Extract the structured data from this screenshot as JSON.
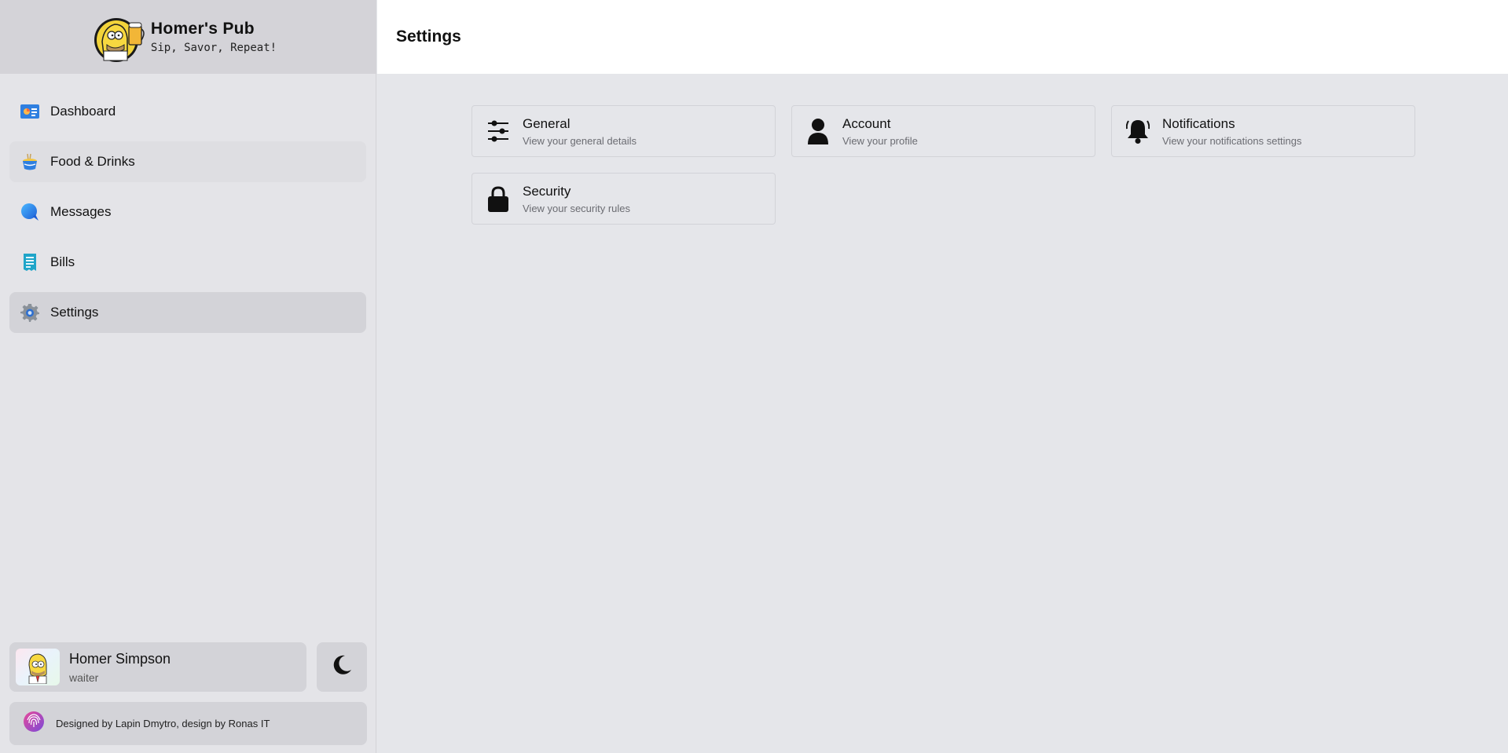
{
  "brand": {
    "title": "Homer's Pub",
    "subtitle": "Sip, Savor, Repeat!",
    "logo_icon": "homer-beer-logo-icon"
  },
  "sidebar": {
    "items": [
      {
        "label": "Dashboard",
        "icon": "dashboard-icon"
      },
      {
        "label": "Food & Drinks",
        "icon": "food-bowl-icon"
      },
      {
        "label": "Messages",
        "icon": "speech-bubble-icon"
      },
      {
        "label": "Bills",
        "icon": "receipt-icon"
      },
      {
        "label": "Settings",
        "icon": "gear-icon",
        "active": true
      }
    ]
  },
  "user": {
    "name": "Homer Simpson",
    "role": "waiter",
    "avatar_icon": "homer-avatar-icon"
  },
  "theme_toggle": {
    "icon": "moon-icon"
  },
  "credits": {
    "text": "Designed by Lapin Dmytro, design by Ronas IT",
    "icon": "fingerprint-icon"
  },
  "header": {
    "title": "Settings"
  },
  "settings_cards": [
    {
      "title": "General",
      "description": "View your general details",
      "icon": "sliders-icon"
    },
    {
      "title": "Account",
      "description": "View your profile",
      "icon": "user-icon"
    },
    {
      "title": "Notifications",
      "description": "View your notifications settings",
      "icon": "bell-icon"
    },
    {
      "title": "Security",
      "description": "View your security rules",
      "icon": "lock-icon"
    }
  ],
  "colors": {
    "sidebar_bg": "#e4e4e8",
    "active_item": "#d3d3d8",
    "main_bg": "#e5e6ea",
    "header_bg": "#ffffff"
  }
}
